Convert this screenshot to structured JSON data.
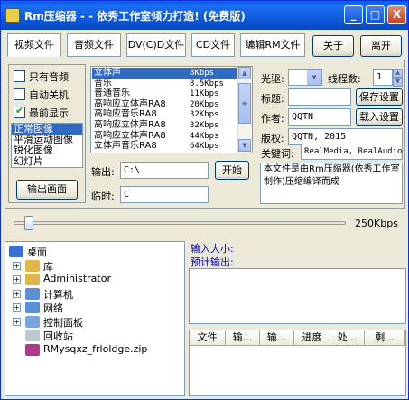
{
  "titlebar": {
    "title": "Rm压缩器 - - 依秀工作室倾力打造! (免费版)",
    "min_symbol": "_",
    "max_symbol": "□",
    "close_symbol": "X"
  },
  "tabs": [
    "视频文件",
    "音频文件",
    "DV(C)D文件",
    "CD文件",
    "编辑RM文件"
  ],
  "toolbar": {
    "about_label": "关于",
    "exit_label": "离开"
  },
  "options": {
    "audio_only": "只有音频",
    "auto_shutdown": "自动关机",
    "always_on_top": "最前显示",
    "output_screen_button": "输出画面"
  },
  "image_modes": [
    "正常图像",
    "平滑运动图像",
    "锐化图像",
    "幻灯片"
  ],
  "presets": [
    {
      "name": "立体声",
      "rate": "8Kbps"
    },
    {
      "name": "音乐",
      "rate": "8.5Kbps"
    },
    {
      "name": "普通音乐",
      "rate": "11Kbps"
    },
    {
      "name": "高响应立体声RA8",
      "rate": "20Kbps"
    },
    {
      "name": "高响应音乐RA8",
      "rate": "32Kbps"
    },
    {
      "name": "高响应立体声RA8",
      "rate": "32Kbps"
    },
    {
      "name": "高响应立体声RA8",
      "rate": "44Kbps"
    },
    {
      "name": "立体声音乐RA8",
      "rate": "64Kbps"
    }
  ],
  "io": {
    "output_label": "输出:",
    "output_value": "C:\\",
    "start_button": "开始",
    "temp_label": "临时:",
    "temp_value": "C"
  },
  "meta": {
    "drive_label": "光驱:",
    "threads_label": "线程数:",
    "threads_value": "1",
    "title_label": "标题:",
    "save_button": "保存设置",
    "author_label": "作者:",
    "author_value": "QQTN",
    "load_button": "载入设置",
    "copyright_label": "版权:",
    "copyright_value": "QQTN, 2015",
    "keywords_label": "关键词:",
    "keywords_value": "RealMedia, RealAudio",
    "description": "本文件是由Rm压缩器(依秀工作室制作)压缩编译而成"
  },
  "bitrate": {
    "value_label": "250Kbps"
  },
  "tree": [
    {
      "label": "桌面",
      "icon": "desktop-icon",
      "color": "#3a6fd8",
      "expandable": false,
      "level": 0
    },
    {
      "label": "库",
      "icon": "library-icon",
      "color": "#e0b64a",
      "expandable": true,
      "level": 1
    },
    {
      "label": "Administrator",
      "icon": "user-folder-icon",
      "color": "#e0b64a",
      "expandable": true,
      "level": 1
    },
    {
      "label": "计算机",
      "icon": "computer-icon",
      "color": "#5b8fd6",
      "expandable": true,
      "level": 1
    },
    {
      "label": "网络",
      "icon": "network-icon",
      "color": "#5b8fd6",
      "expandable": true,
      "level": 1
    },
    {
      "label": "控制面板",
      "icon": "control-panel-icon",
      "color": "#7aa4de",
      "expandable": true,
      "level": 1
    },
    {
      "label": "回收站",
      "icon": "recycle-bin-icon",
      "color": "#bfc7d2",
      "expandable": false,
      "level": 1
    },
    {
      "label": "RMysqxz_frloldge.zip",
      "icon": "zip-file-icon",
      "color": "#b03a8a",
      "expandable": false,
      "level": 1
    }
  ],
  "info": {
    "input_size_label": "输入大小:",
    "estimated_output_label": "预计输出:"
  },
  "queue_headers": [
    "文件",
    "输...",
    "输...",
    "进度",
    "处...",
    "剩..."
  ],
  "colors": {
    "accent": "#0a5fe8",
    "selection": "#316ac5",
    "info_text": "#0000c0"
  }
}
